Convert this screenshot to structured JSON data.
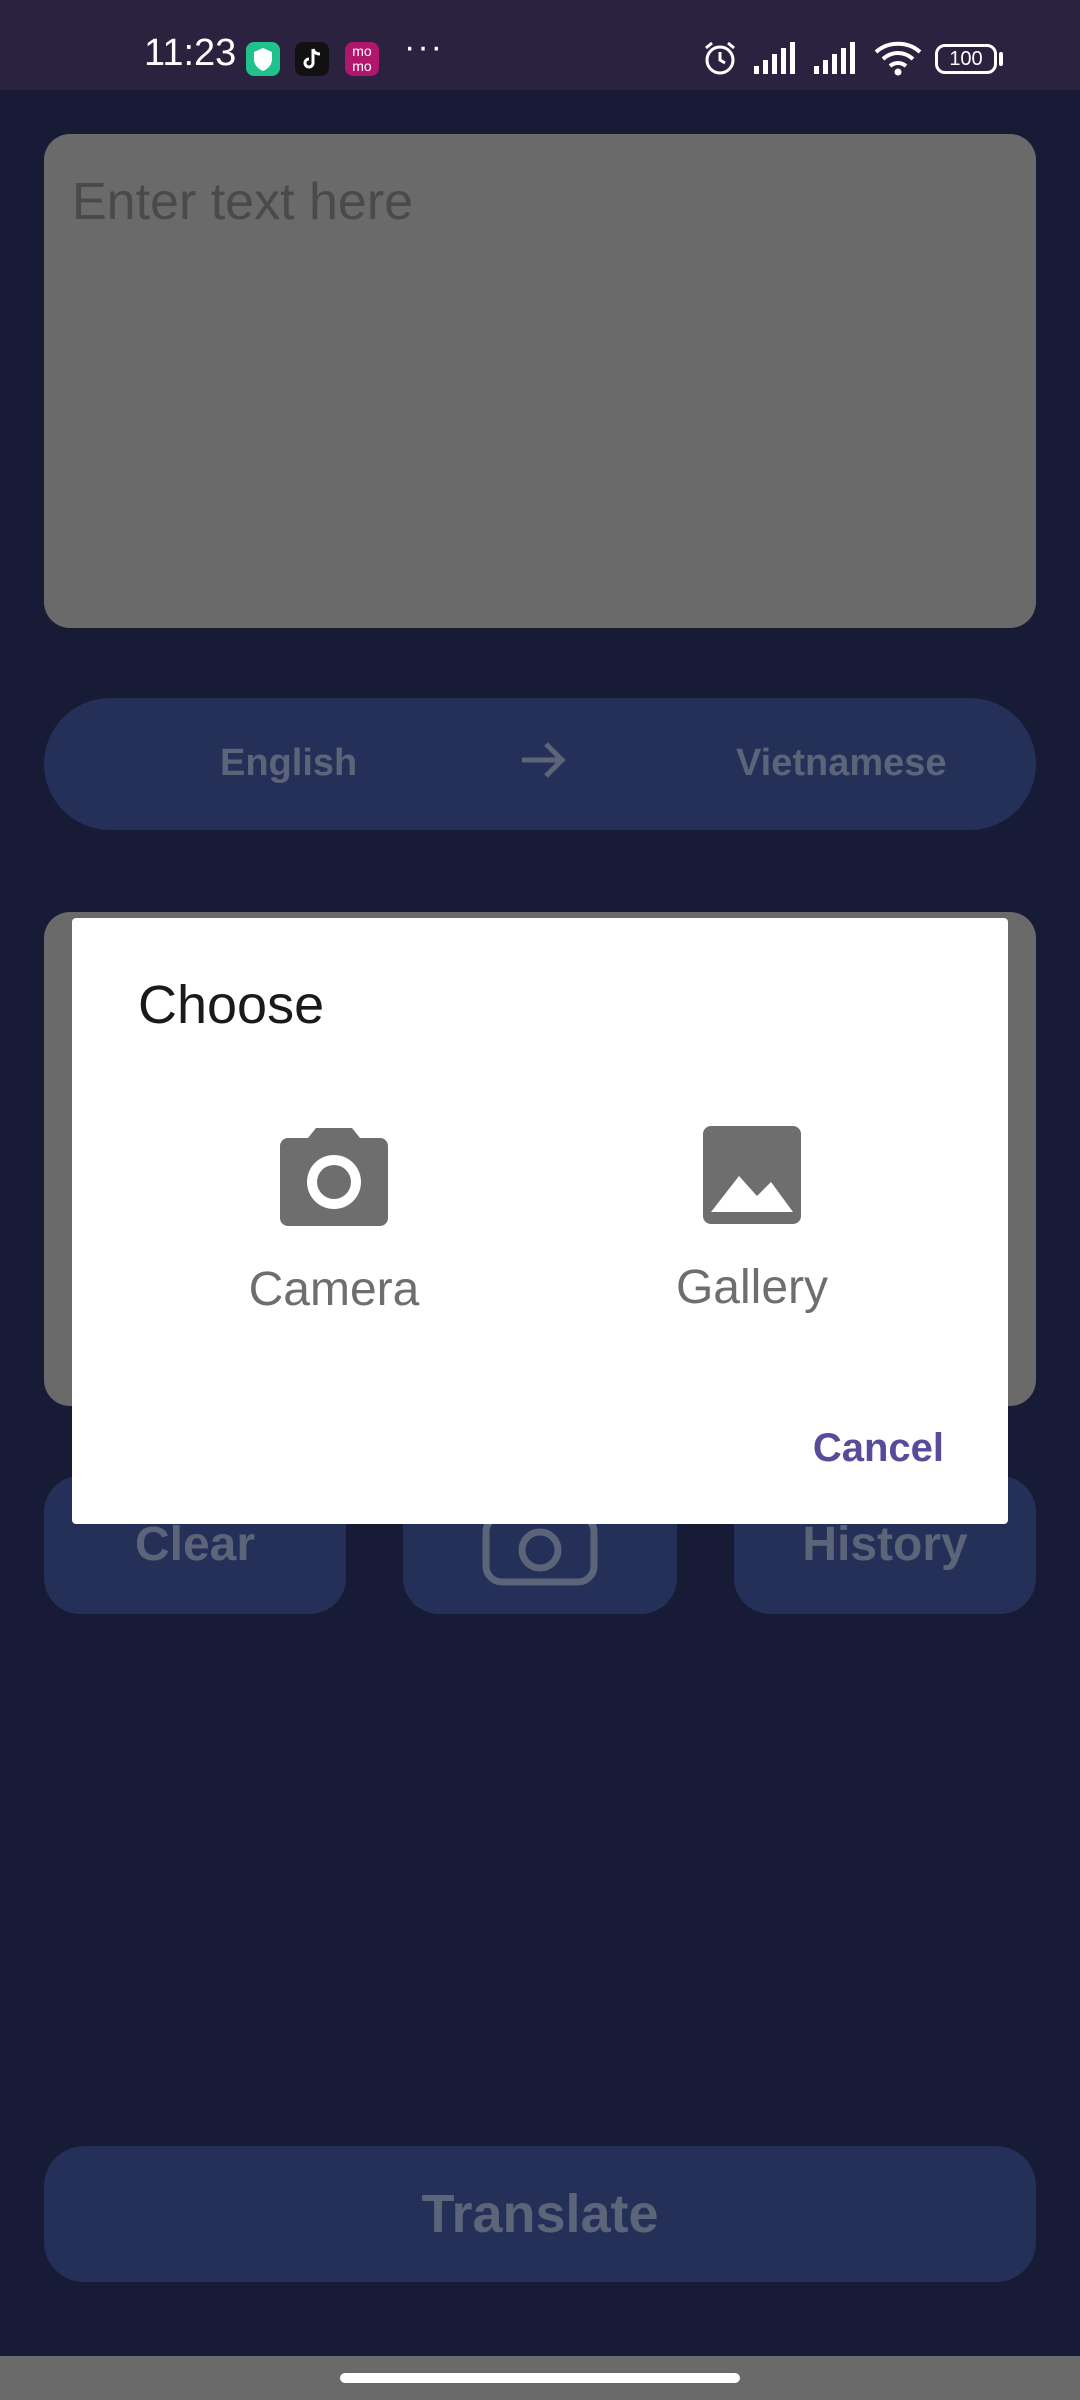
{
  "status_bar": {
    "time": "11:23",
    "app_icons": [
      "shield-app-icon",
      "tiktok-icon",
      "momo-icon"
    ],
    "more": "···",
    "momo_label": "mo mo",
    "battery": "100"
  },
  "input": {
    "placeholder": "Enter text here"
  },
  "language_bar": {
    "source": "English",
    "target": "Vietnamese"
  },
  "actions": {
    "clear_label": "Clear",
    "history_label": "History"
  },
  "translate_label": "Translate",
  "dialog": {
    "title": "Choose",
    "camera_label": "Camera",
    "gallery_label": "Gallery",
    "cancel_label": "Cancel"
  },
  "colors": {
    "background": "#181b35",
    "status_bar": "#2b2240",
    "button": "#243057",
    "accent": "#5a4a9a"
  }
}
